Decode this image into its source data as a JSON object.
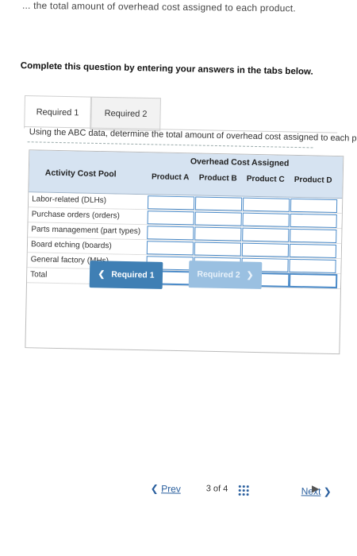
{
  "top_cut_text": "... the total amount of overhead cost assigned to each product.",
  "instruction": "Complete this question by entering your answers in the tabs below.",
  "tabs": [
    {
      "label": "Required 1",
      "active": true
    },
    {
      "label": "Required 2",
      "active": false
    }
  ],
  "prompt": "Using the ABC data, determine the total amount of overhead cost assigned to each product.",
  "table": {
    "group_header": "Overhead Cost Assigned",
    "pool_header": "Activity Cost Pool",
    "columns": [
      "Product A",
      "Product B",
      "Product C",
      "Product D"
    ],
    "rows": [
      "Labor-related (DLHs)",
      "Purchase orders (orders)",
      "Parts management (part types)",
      "Board etching (boards)",
      "General factory (MHs)",
      "Total"
    ]
  },
  "buttons": {
    "req1": "Required 1",
    "req2": "Required 2"
  },
  "footer": {
    "prev": "Prev",
    "page_current": "3",
    "page_of": "of",
    "page_total": "4",
    "next": "Next"
  },
  "colors": {
    "header_band": "#d6e3f1",
    "button_primary": "#3f7fb4",
    "button_disabled": "#9ac0e1",
    "link": "#2a5f9e"
  }
}
